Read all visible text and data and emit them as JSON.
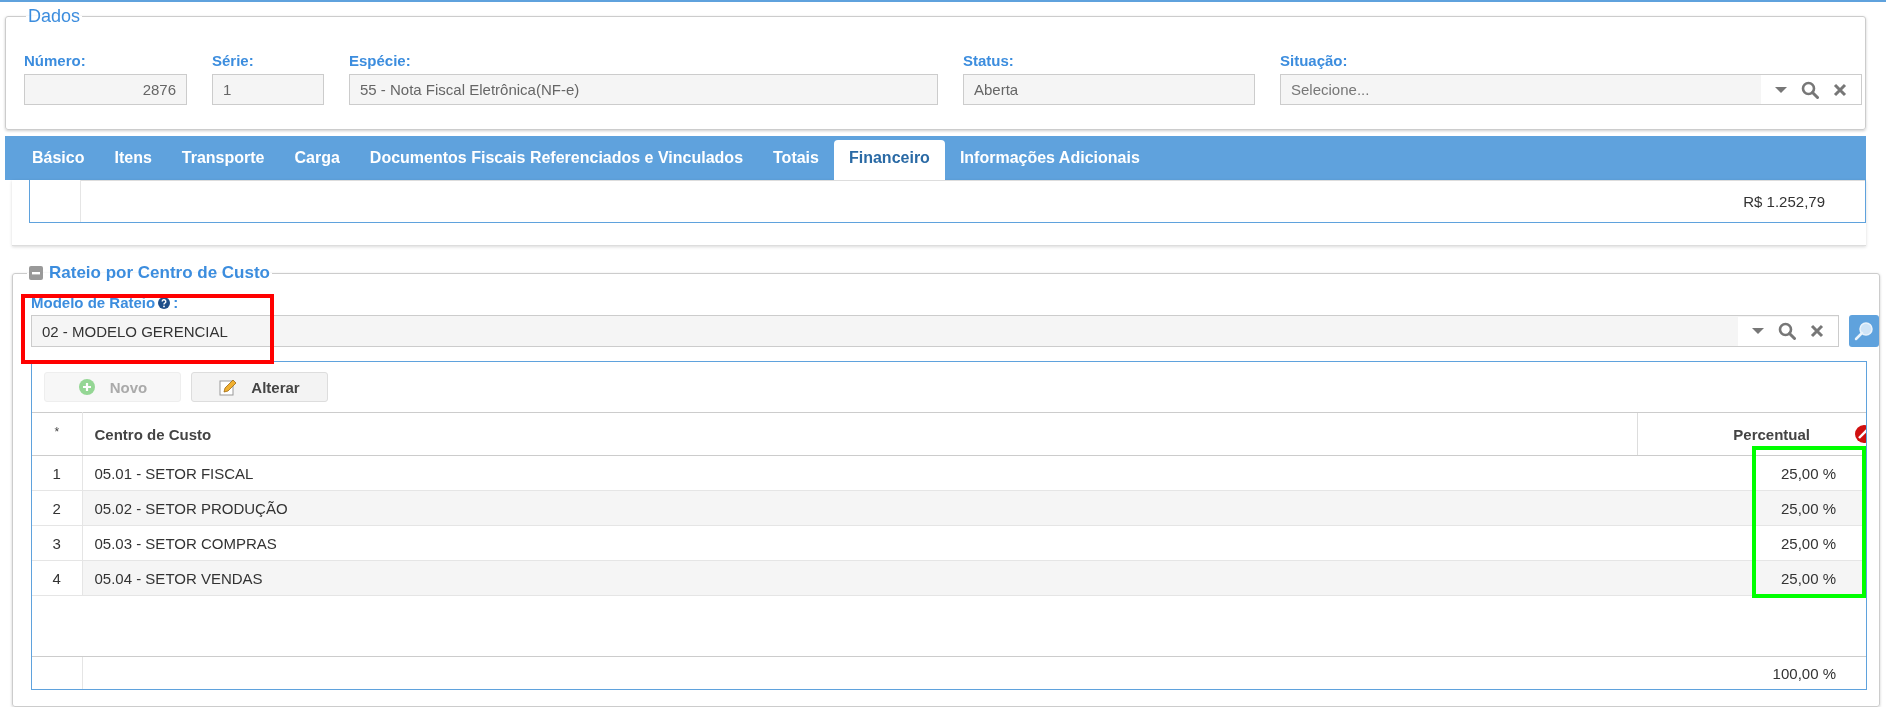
{
  "dados": {
    "title": "Dados",
    "fields": [
      {
        "label": "Número:",
        "value": "2876",
        "kind": "number"
      },
      {
        "label": "Série:",
        "value": "1",
        "kind": "text"
      },
      {
        "label": "Espécie:",
        "value": "55 - Nota Fiscal Eletrônica(NF-e)",
        "kind": "text"
      },
      {
        "label": "Status:",
        "value": "Aberta",
        "kind": "text"
      },
      {
        "label": "Situação:",
        "placeholder": "Selecione...",
        "kind": "lookup"
      }
    ]
  },
  "tabs": [
    {
      "label": "Básico",
      "selected": false
    },
    {
      "label": "Itens",
      "selected": false
    },
    {
      "label": "Transporte",
      "selected": false
    },
    {
      "label": "Carga",
      "selected": false
    },
    {
      "label": "Documentos Fiscais Referenciados e Vinculados",
      "selected": false
    },
    {
      "label": "Totais",
      "selected": false
    },
    {
      "label": "Financeiro",
      "selected": true
    },
    {
      "label": "Informações Adicionais",
      "selected": false
    }
  ],
  "previous_table": {
    "total": "R$ 1.252,79"
  },
  "rateio": {
    "title": "Rateio por Centro de Custo",
    "expanded": true,
    "modelo": {
      "label": "Modelo de Rateio",
      "suffix": ":",
      "value": "02 - MODELO GERENCIAL"
    },
    "toolbar": [
      {
        "label": "Novo",
        "kind": "add",
        "disabled": true
      },
      {
        "label": "Alterar",
        "kind": "edit",
        "disabled": false
      }
    ],
    "columns": [
      "*",
      "Centro de Custo",
      "Percentual"
    ],
    "rows": [
      {
        "index": "1",
        "centro": "05.01 - SETOR FISCAL",
        "percentual": "25,00 %"
      },
      {
        "index": "2",
        "centro": "05.02 - SETOR PRODUÇÃO",
        "percentual": "25,00 %"
      },
      {
        "index": "3",
        "centro": "05.03 - SETOR COMPRAS",
        "percentual": "25,00 %"
      },
      {
        "index": "4",
        "centro": "05.04 - SETOR VENDAS",
        "percentual": "25,00 %"
      }
    ],
    "footer_total": "100,00 %"
  },
  "annotations": [
    {
      "kind": "modelo",
      "color": "#ff0000"
    },
    {
      "kind": "percentual",
      "color": "#00ff00"
    }
  ]
}
